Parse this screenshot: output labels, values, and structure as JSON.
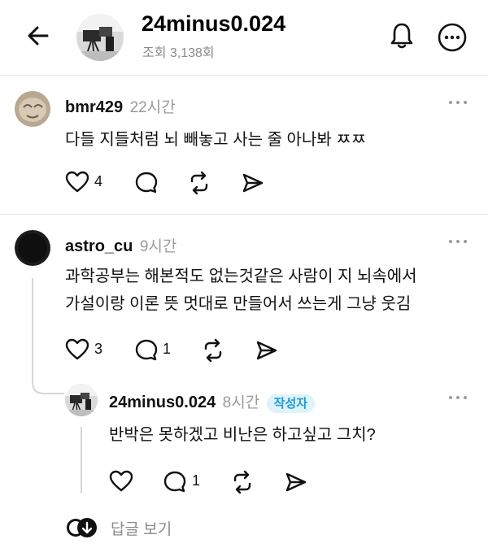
{
  "header": {
    "title": "24minus0.024",
    "subtitle": "조회 3,138회"
  },
  "comments": [
    {
      "username": "bmr429",
      "time": "22시간",
      "text": "다들 지들처럼 뇌 빼놓고 사는 줄 아나봐 ㅉㅉ",
      "likes": "4"
    },
    {
      "username": "astro_cu",
      "time": "9시간",
      "text_line1": "과학공부는 해본적도 없는것같은 사람이 지 뇌속에서",
      "text_line2": "가설이랑 이론 뜻 멋대로 만들어서 쓰는게 그냥 웃김",
      "likes": "3",
      "replies": "1"
    }
  ],
  "reply": {
    "username": "24minus0.024",
    "time": "8시간",
    "badge": "작성자",
    "text": "반박은 못하겠고 비난은 하고싶고 그치?",
    "replies": "1"
  },
  "view_replies_label": "답글 보기"
}
